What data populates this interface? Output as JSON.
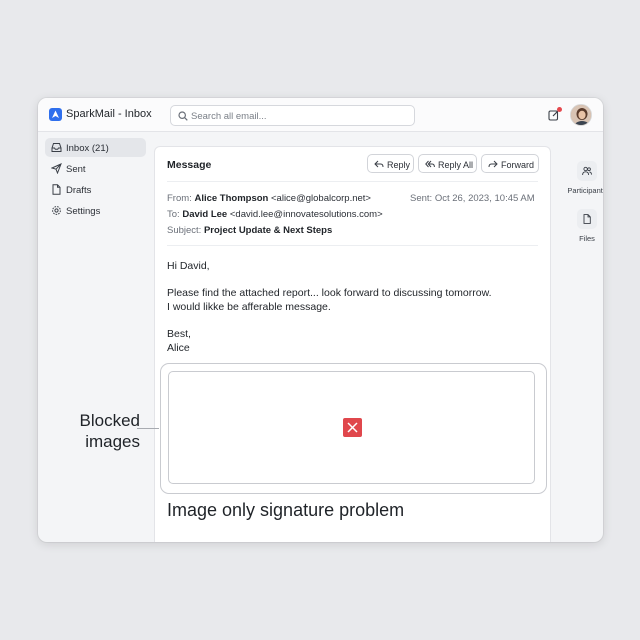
{
  "window": {
    "title": "SparkMail - Inbox"
  },
  "search": {
    "placeholder": "Search all email..."
  },
  "sidebar": {
    "items": [
      {
        "label": "Inbox (21)",
        "icon": "inbox-icon",
        "active": true
      },
      {
        "label": "Sent",
        "icon": "send-icon",
        "active": false
      },
      {
        "label": "Drafts",
        "icon": "file-icon",
        "active": false
      },
      {
        "label": "Settings",
        "icon": "gear-icon",
        "active": false
      }
    ]
  },
  "message": {
    "section_title": "Message",
    "actions": {
      "reply": "Reply",
      "reply_all": "Reply All",
      "forward": "Forward"
    },
    "from_label": "From:",
    "from_name": "Alice Thompson",
    "from_email": "<alice@globalcorp.net>",
    "to_label": "To:",
    "to_name": "David Lee",
    "to_email": "<david.lee@innovatesolutions.com>",
    "subject_label": "Subject:",
    "subject": "Project Update & Next Steps",
    "sent": "Sent: Oct 26, 2023, 10:45 AM",
    "body": {
      "greeting": "Hi David,",
      "line1": "Please find the attached report... look forward to discussing tomorrow.",
      "line2": "I would likke be afferable message.",
      "closing": "Best,",
      "signoff": "Alice"
    }
  },
  "signature_caption": "Image only signature problem",
  "callout": {
    "line1": "Blocked",
    "line2": "images"
  },
  "rightbar": {
    "participants": "Participants",
    "files": "Files"
  },
  "colors": {
    "accent": "#2f6fed",
    "broken_image": "#e0474c",
    "notification": "#e5484d"
  }
}
